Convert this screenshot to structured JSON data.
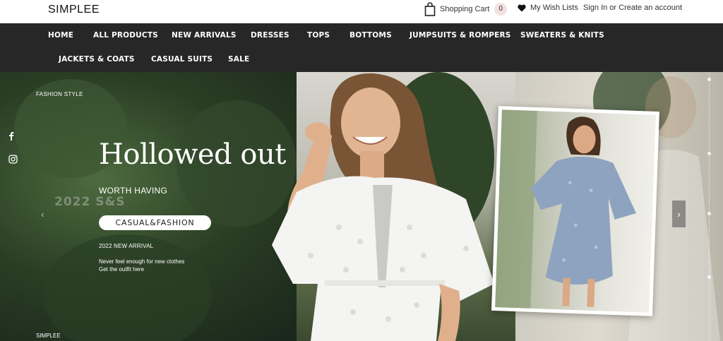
{
  "header": {
    "logo": "SIMPLEE",
    "cart_label": "Shopping Cart",
    "cart_count": "0",
    "wishlist_label": "My Wish Lists",
    "sign_in": "Sign In",
    "or": " or ",
    "create_account": "Create an account"
  },
  "nav": {
    "items": [
      "HOME",
      "ALL PRODUCTS",
      "NEW ARRIVALS",
      "DRESSES",
      "TOPS",
      "BOTTOMS",
      "JUMPSUITS & ROMPERS",
      "SWEATERS & KNITS",
      "JACKETS & COATS",
      "CASUAL SUITS",
      "SALE"
    ]
  },
  "hero": {
    "tagline": "FASHION STYLE",
    "headline": "Hollowed out",
    "subhead": "WORTH HAVING",
    "ghost_text": "2022 S&S",
    "pill_label": "CASUAL&FASHION",
    "arrival": "2022 NEW ARRIVAL",
    "desc_line1": "Never feel enough for new clothes",
    "desc_line2": "Get the outfit here",
    "footer_brand": "SIMPLEE",
    "social_icons": [
      "facebook-icon",
      "instagram-icon"
    ]
  },
  "colors": {
    "nav_bg": "#272727",
    "badge_bg": "#f3e0e0",
    "dress_white": "#f4f4f2",
    "dress_blue": "#8ea3bf"
  }
}
